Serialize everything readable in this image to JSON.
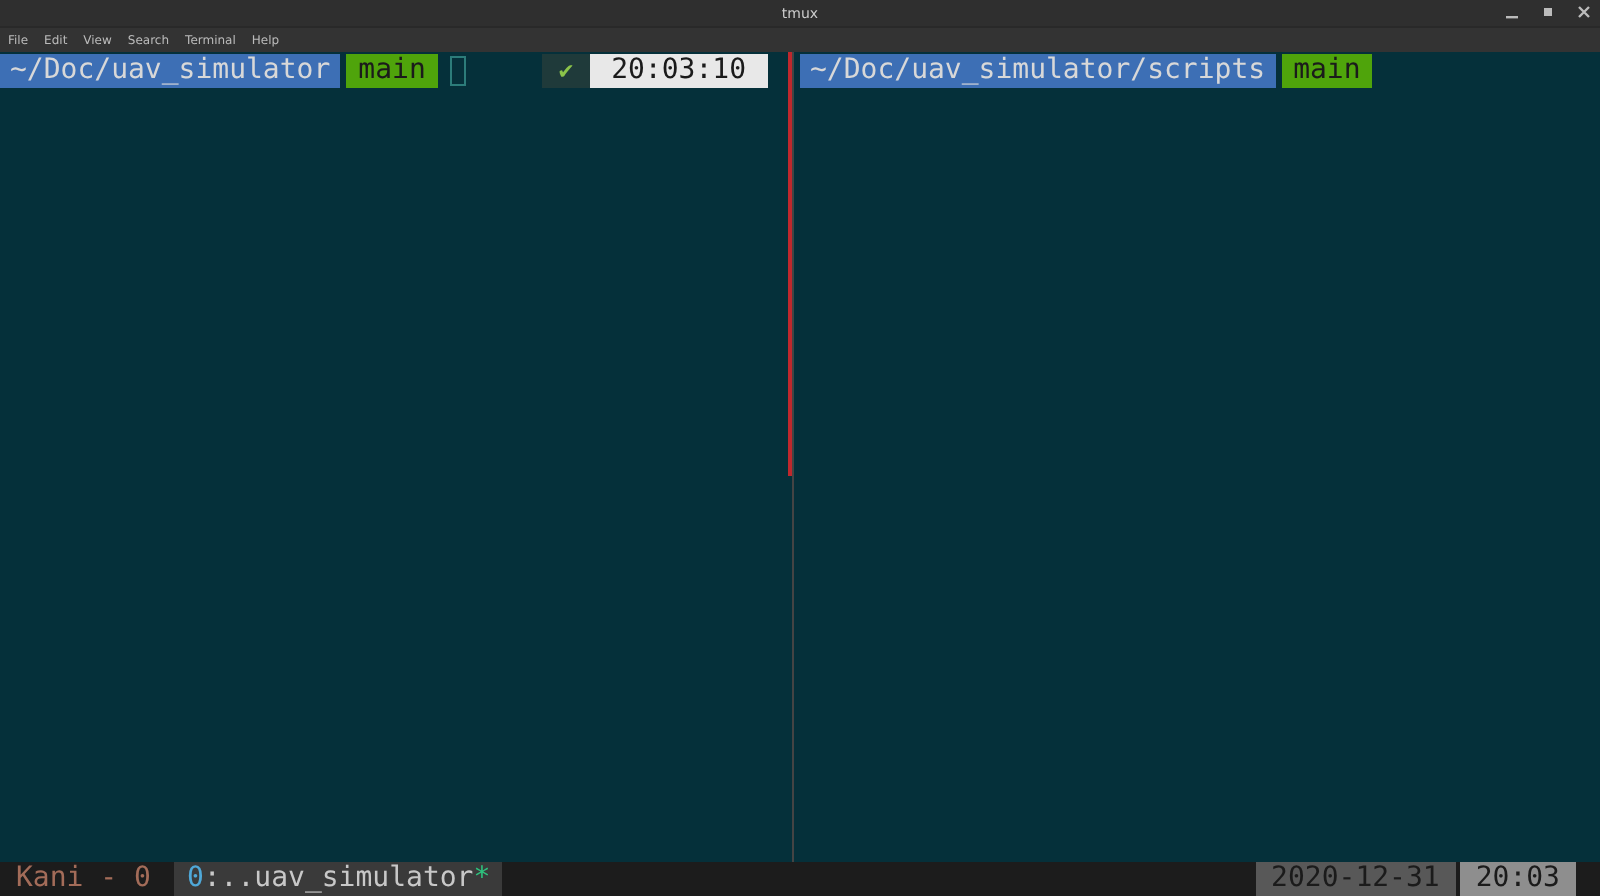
{
  "window": {
    "title": "tmux"
  },
  "menu": [
    "File",
    "Edit",
    "View",
    "Search",
    "Terminal",
    "Help"
  ],
  "panes": [
    {
      "active": true,
      "path": "~/Doc/uav_simulator",
      "branch": "main",
      "cursor": true,
      "status": "✔",
      "time": "20:03:10"
    },
    {
      "active": false,
      "path": "~/Doc/uav_simulator/scripts",
      "branch": "main",
      "cursor": false
    }
  ],
  "status_bar": {
    "session": "Kani - 0",
    "windows": [
      {
        "index": "0",
        "name": ":..uav_simulator",
        "flag": "*",
        "selected": true
      }
    ],
    "date": "2020-12-31",
    "time": "20:03"
  }
}
